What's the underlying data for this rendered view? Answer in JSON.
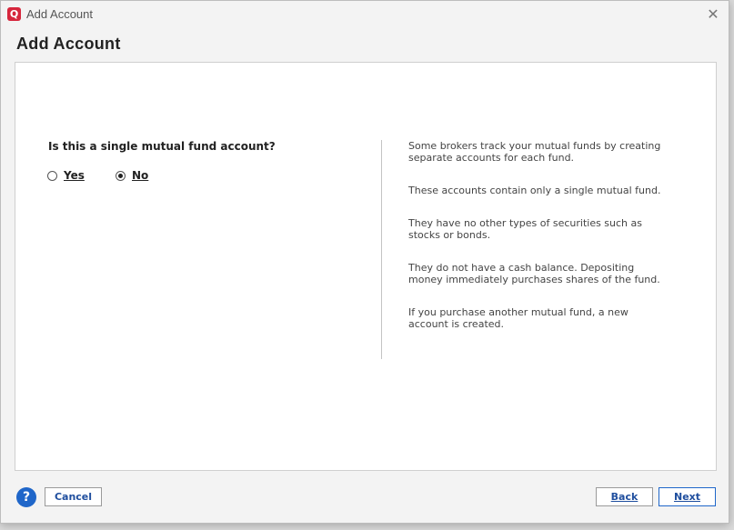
{
  "window": {
    "title": "Add Account",
    "heading": "Add Account",
    "logo_letter": "Q",
    "close_glyph": "✕"
  },
  "form": {
    "question": "Is this a single mutual fund account?",
    "options": [
      {
        "label": "Yes",
        "selected": false
      },
      {
        "label": "No",
        "selected": true
      }
    ]
  },
  "info": {
    "paragraphs": [
      "Some brokers track your mutual funds by creating separate accounts for each fund.",
      "These accounts contain only a single mutual fund.",
      "They have no other types of securities such as stocks or bonds.",
      "They do not have a cash balance. Depositing money immediately purchases shares of the fund.",
      "If you purchase another mutual fund, a new account is created."
    ]
  },
  "footer": {
    "help_glyph": "?",
    "cancel_label": "Cancel",
    "back_label": "Back",
    "next_label": "Next"
  },
  "colors": {
    "brand_red": "#d6263c",
    "accent_blue": "#1f66c9"
  }
}
